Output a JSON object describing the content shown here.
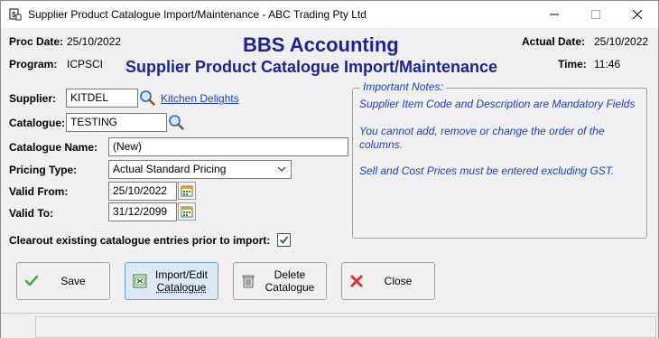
{
  "window": {
    "title": "Supplier Product Catalogue Import/Maintenance - ABC Trading Pty Ltd",
    "app_icon": "bbs-app-icon"
  },
  "header": {
    "proc_date_label": "Proc Date:",
    "proc_date": "25/10/2022",
    "program_label": "Program:",
    "program": "ICPSCI",
    "company": "BBS Accounting",
    "screen_title": "Supplier Product Catalogue Import/Maintenance",
    "actual_date_label": "Actual Date:",
    "actual_date": "25/10/2022",
    "time_label": "Time:",
    "time": "11:46"
  },
  "form": {
    "supplier_label": "Supplier:",
    "supplier_code": "KITDEL",
    "supplier_name": "Kitchen Delights",
    "catalogue_label": "Catalogue:",
    "catalogue_code": "TESTING",
    "catalogue_name_label": "Catalogue Name:",
    "catalogue_name": "(New)",
    "pricing_type_label": "Pricing Type:",
    "pricing_type": "Actual Standard Pricing",
    "valid_from_label": "Valid From:",
    "valid_from": "25/10/2022",
    "valid_to_label": "Valid To:",
    "valid_to": "31/12/2099",
    "clearout_label": "Clearout existing catalogue entries prior to import:",
    "clearout_checked": true
  },
  "notes": {
    "legend": "Important Notes:",
    "line1": "Supplier Item Code and Description are Mandatory Fields",
    "line2": "You cannot add, remove or change the order of the",
    "line3": "columns.",
    "line4": "Sell and Cost Prices must be entered excluding GST."
  },
  "buttons": {
    "save": "Save",
    "import_edit_line1": "Import/Edit",
    "import_edit_line2": "Catalogue",
    "delete_line1": "Delete",
    "delete_line2": "Catalogue",
    "close": "Close"
  },
  "colors": {
    "heading_blue": "#1f1f96",
    "link_blue": "#1a3fbf",
    "save_green": "#3cb043",
    "close_red": "#e03030"
  }
}
